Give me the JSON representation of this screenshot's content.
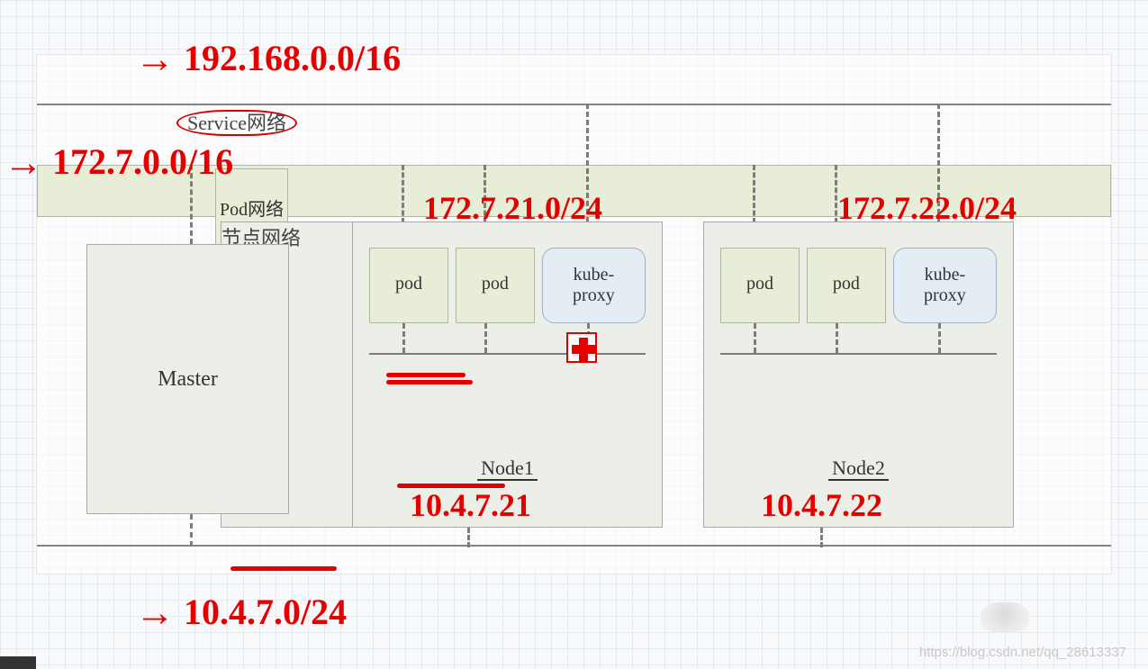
{
  "networks": {
    "service": {
      "label": "Service网络",
      "cidr_annotation": "192.168.0.0/16"
    },
    "pod": {
      "label": "Pod网络",
      "cidr_annotation": "172.7.0.0/16"
    },
    "node": {
      "label": "节点网络",
      "cidr_annotation": "10.4.7.0/24"
    }
  },
  "master": {
    "label": "Master"
  },
  "nodes": [
    {
      "name": "Node1",
      "pods": [
        "pod",
        "pod"
      ],
      "proxy_lines": [
        "kube-",
        "proxy"
      ],
      "pod_subnet_annotation": "172.7.21.0/24",
      "node_ip_annotation": "10.4.7.21"
    },
    {
      "name": "Node2",
      "pods": [
        "pod",
        "pod"
      ],
      "proxy_lines": [
        "kube-",
        "proxy"
      ],
      "pod_subnet_annotation": "172.7.22.0/24",
      "node_ip_annotation": "10.4.7.22"
    }
  ],
  "icons": {
    "cross": "medic-cross-icon"
  },
  "watermark": "https://blog.csdn.net/qq_28613337",
  "arrow_glyph": "→"
}
